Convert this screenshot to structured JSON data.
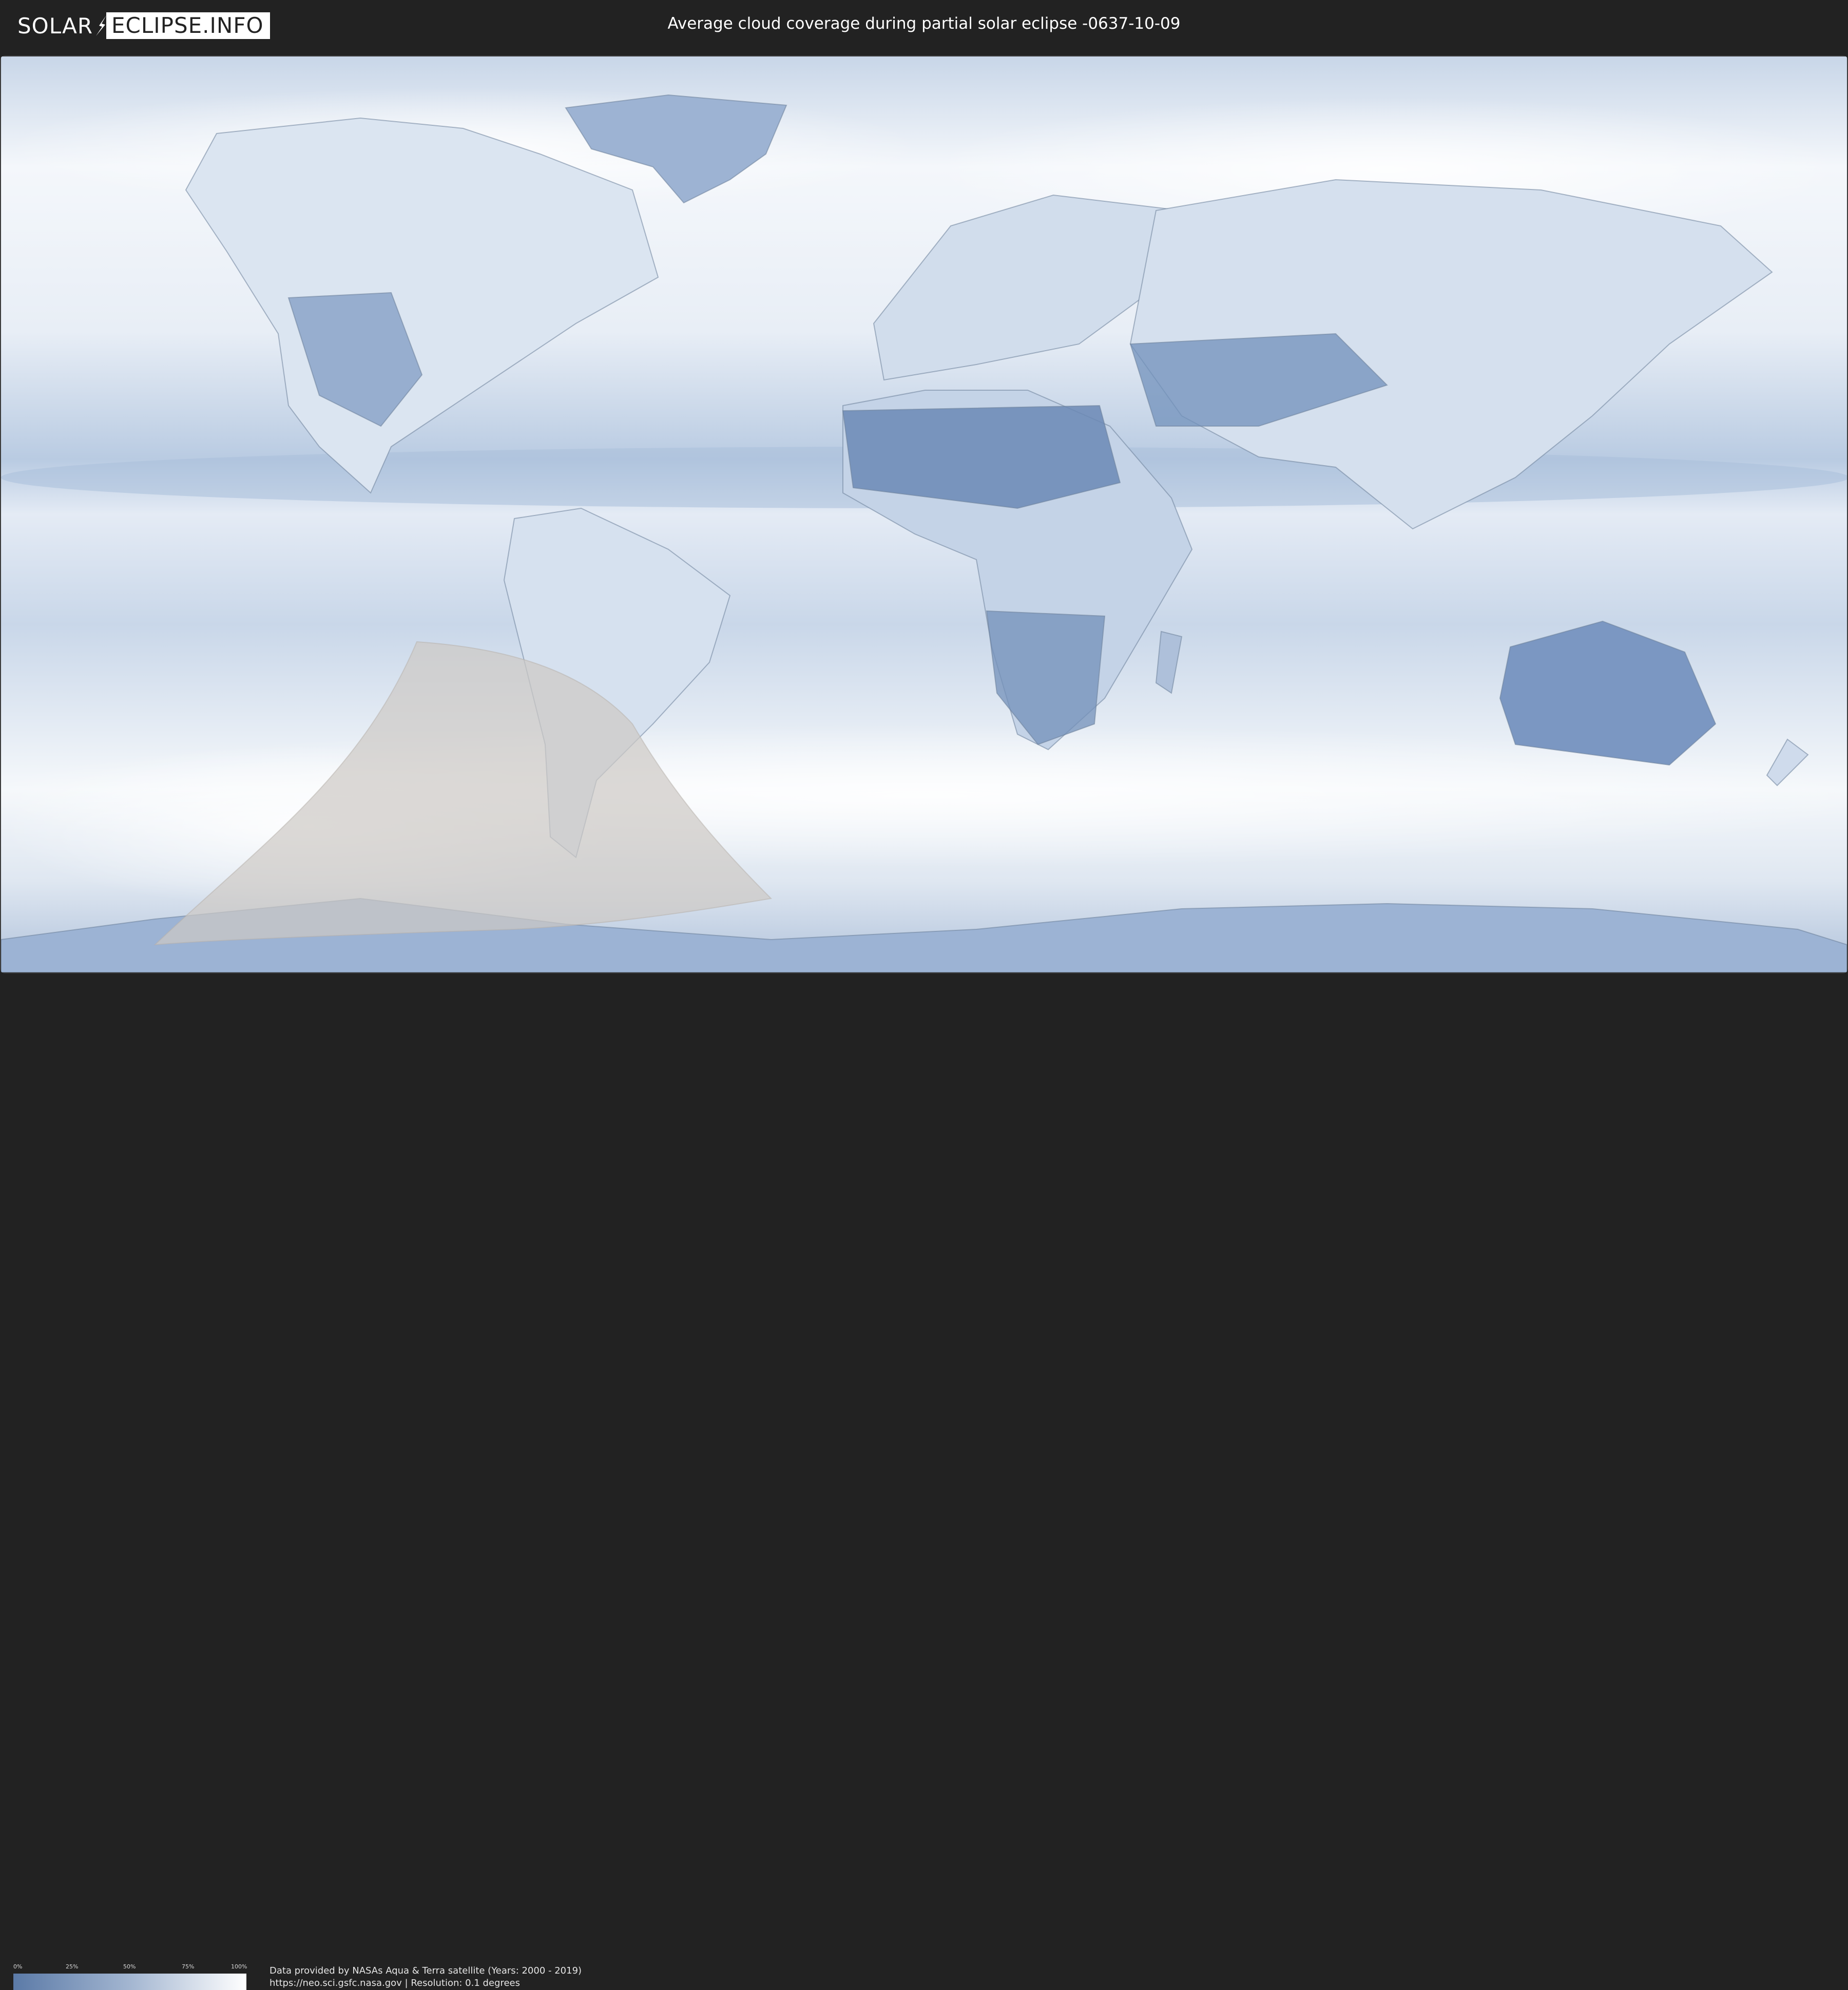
{
  "header": {
    "logo_left": "SOLAR",
    "logo_right": "ECLIPSE.INFO",
    "title": "Average cloud coverage during partial solar eclipse -0637-10-09"
  },
  "legend": {
    "ticks": [
      "0%",
      "25%",
      "50%",
      "75%",
      "100%"
    ],
    "color_low": "#5b7aa7",
    "color_high": "#ffffff"
  },
  "credits": {
    "line1": "Data provided by NASAs Aqua & Terra satellite (Years: 2000 - 2019)",
    "line2": "https://neo.sci.gsfc.nasa.gov | Resolution: 0.1 degrees"
  },
  "colors": {
    "background": "#222222",
    "cloud_clear": "#5b7aa7",
    "cloud_full": "#ffffff",
    "eclipse_shadow": "#cdc9c4"
  }
}
